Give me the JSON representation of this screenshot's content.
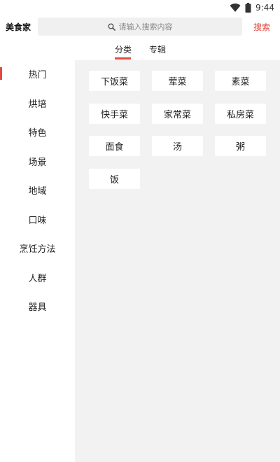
{
  "status_bar": {
    "time": "9:44",
    "icons": [
      "wifi-icon",
      "battery-icon"
    ]
  },
  "header": {
    "app_title": "美食家",
    "search": {
      "placeholder": "请输入搜索内容",
      "icon": "search-icon"
    },
    "search_button": "搜索"
  },
  "tabs": [
    {
      "label": "分类",
      "active": true
    },
    {
      "label": "专辑",
      "active": false
    }
  ],
  "sidebar": {
    "items": [
      {
        "label": "热门",
        "active": true
      },
      {
        "label": "烘培",
        "active": false
      },
      {
        "label": "特色",
        "active": false
      },
      {
        "label": "场景",
        "active": false
      },
      {
        "label": "地域",
        "active": false
      },
      {
        "label": "口味",
        "active": false
      },
      {
        "label": "烹饪方法",
        "active": false
      },
      {
        "label": "人群",
        "active": false
      },
      {
        "label": "器具",
        "active": false
      }
    ]
  },
  "categories": [
    "下饭菜",
    "荤菜",
    "素菜",
    "快手菜",
    "家常菜",
    "私房菜",
    "面食",
    "汤",
    "粥",
    "饭"
  ],
  "colors": {
    "accent": "#e04a3f",
    "content_bg": "#f2f2f2",
    "search_bg": "#f0f0f0"
  }
}
